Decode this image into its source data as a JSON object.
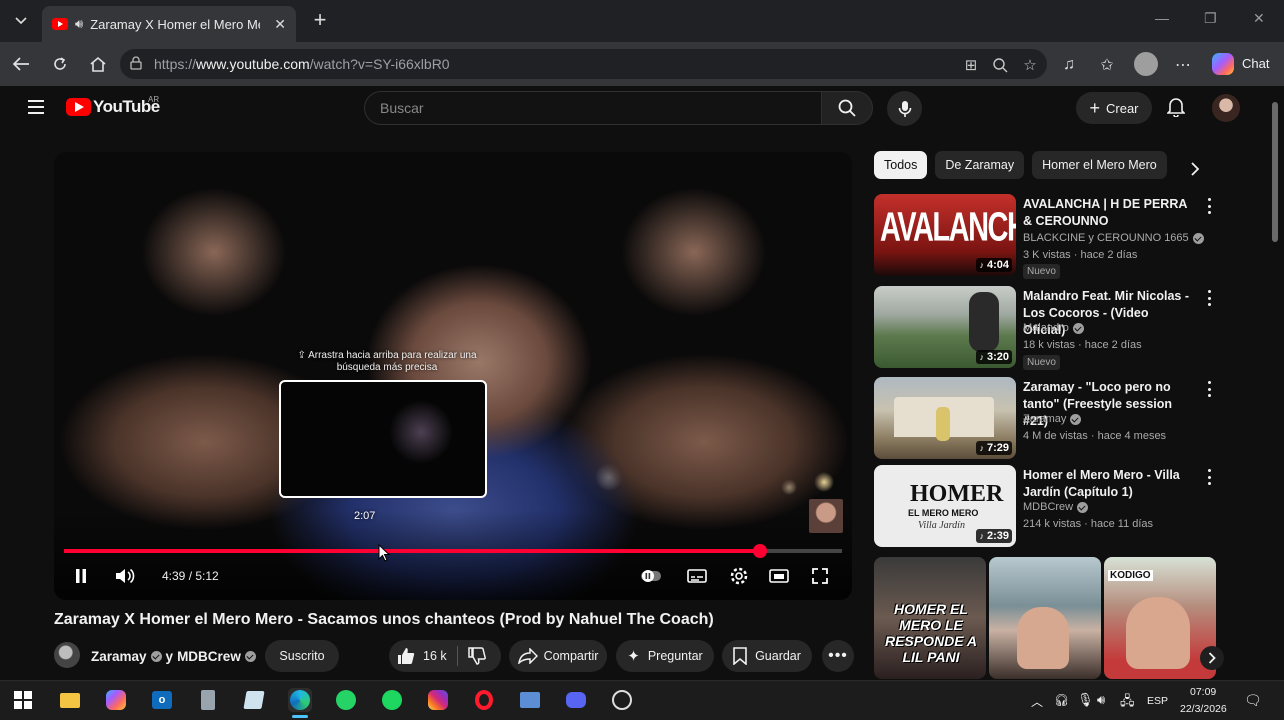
{
  "browser": {
    "tab_title": "Zaramay X Homer el Mero Mero - Sacamos unos chanteos (Prod by Nahuel The Coach) - YouTube",
    "url_prefix": "https://",
    "url_host": "www.youtube.com",
    "url_path": "/watch?v=SY-i66xlbR0",
    "chat_label": "Chat"
  },
  "youtube": {
    "logo_text": "YouTube",
    "country": "AR",
    "search_placeholder": "Buscar",
    "create_label": "Crear"
  },
  "player": {
    "hint_text": "⇪ Arrastra hacia arriba para realizar una búsqueda más precisa",
    "preview_time": "2:07",
    "time_display": "4:39 / 5:12",
    "progress_fraction": 0.894,
    "hover_fraction": 0.41
  },
  "video": {
    "title": "Zaramay X Homer el Mero Mero - Sacamos unos chanteos (Prod by Nahuel The Coach)",
    "channel_1": "Zaramay",
    "channel_joiner": "y",
    "channel_2": "MDBCrew",
    "subscribed_label": "Suscrito",
    "likes": "16 k",
    "share_label": "Compartir",
    "ask_label": "Preguntar",
    "save_label": "Guardar"
  },
  "chips": [
    "Todos",
    "De Zaramay",
    "Homer el Mero Mero"
  ],
  "recommendations": [
    {
      "title": "AVALANCHA | H DE PERRA & CEROUNNO",
      "channel": "BLACKCINE y CEROUNNO 1665",
      "meta": "3 K vistas · hace 2 días",
      "duration": "4:04",
      "badge": "Nuevo",
      "thumb_text": "AVALANCHA"
    },
    {
      "title": "Malandro Feat. Mir Nicolas - Los Cocoros - (Video Oficial)",
      "channel": "Malandro",
      "meta": "18 k vistas · hace 2 días",
      "duration": "3:20",
      "badge": "Nuevo"
    },
    {
      "title": "Zaramay - \"Loco pero no tanto\" (Freestyle session #21)",
      "channel": "Zaramay",
      "meta": "4 M de vistas · hace 4 meses",
      "duration": "7:29"
    },
    {
      "title": "Homer el Mero Mero - Villa Jardín (Capítulo 1)",
      "channel": "MDBCrew",
      "meta": "214 k vistas · hace 11 días",
      "duration": "2:39",
      "thumb_text_1": "HOMER",
      "thumb_text_2": "EL MERO MERO",
      "thumb_text_3": "Villa Jardín"
    }
  ],
  "shorts": [
    {
      "overlay": "HOMER EL MERO LE RESPONDE A LIL PANI"
    },
    {
      "overlay": ""
    },
    {
      "overlay": "KODIGO"
    }
  ],
  "taskbar": {
    "language": "ESP",
    "time": "07:09",
    "date": "22/3/2026"
  }
}
